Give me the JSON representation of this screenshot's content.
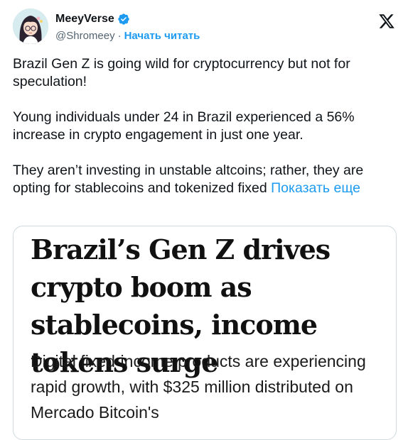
{
  "author": {
    "display_name": "MeeyVerse",
    "handle": "@Shromeey",
    "separator": "·",
    "follow_label": "Начать читать",
    "verified": true,
    "avatar_icon": "avatar-anime-girl-icon",
    "verified_icon": "verified-badge-icon"
  },
  "platform": {
    "logo_icon": "x-logo-icon"
  },
  "tweet": {
    "paragraphs": [
      "Brazil Gen Z is going wild for cryptocurrency but not for speculation!",
      "Young individuals under 24 in Brazil experienced a 56% increase in crypto engagement in just one year.",
      "They aren’t investing in unstable altcoins; rather, they are opting for stablecoins and tokenized fixed"
    ],
    "show_more_label": "Показать еще"
  },
  "card": {
    "headline": "Brazil’s Gen Z drives crypto boom as stablecoins, income tokens surge",
    "subheadline": "Digital fixed-income products are experiencing rapid growth, with $325 million distributed on Mercado Bitcoin's"
  },
  "colors": {
    "accent": "#1d9bf0",
    "text": "#0f1419",
    "muted": "#536471",
    "border": "#cfd9de"
  }
}
